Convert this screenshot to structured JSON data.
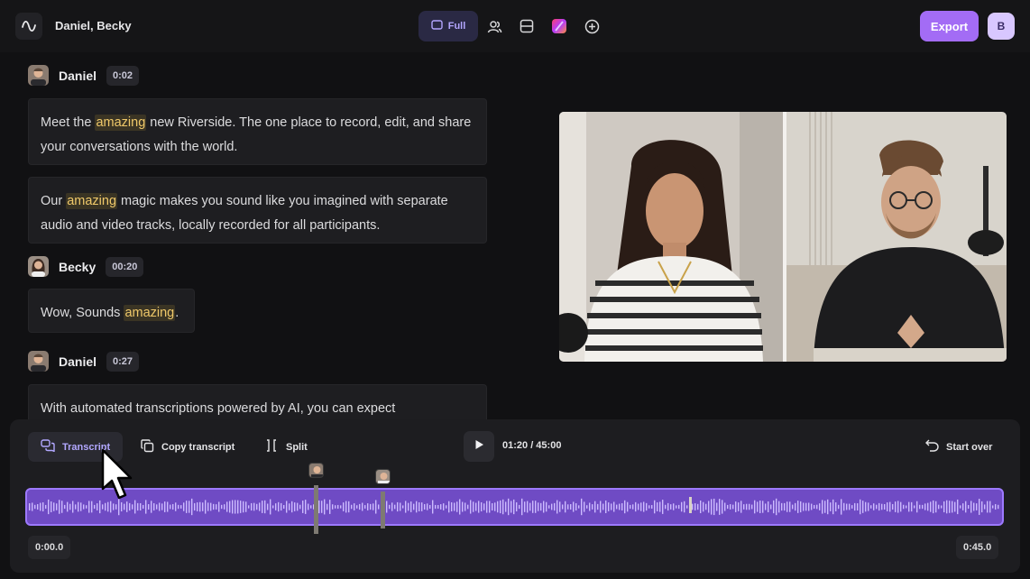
{
  "header": {
    "project_name": "Daniel, Becky",
    "view_full_label": "Full",
    "export_label": "Export",
    "user_initial": "B",
    "icons": [
      "waveform-logo-icon",
      "layout-full-icon",
      "people-icon",
      "split-layout-icon",
      "brand-gradient-icon",
      "add-circle-icon"
    ]
  },
  "transcript": {
    "segments": [
      {
        "speaker": "Daniel",
        "time": "0:02",
        "paragraphs": [
          {
            "before": "Meet the ",
            "highlight": "amazing",
            "after": " new Riverside. The one place to record, edit, and share your conversations with the world."
          },
          {
            "before": "Our ",
            "highlight": "amazing",
            "after": " magic makes you sound like you imagined with separate audio and video tracks, locally recorded for all participants."
          }
        ]
      },
      {
        "speaker": "Becky",
        "time": "00:20",
        "paragraphs": [
          {
            "before": "Wow, Sounds ",
            "highlight": "amazing",
            "after": "."
          }
        ]
      },
      {
        "speaker": "Daniel",
        "time": "0:27",
        "paragraphs": [
          {
            "before": "With automated transcriptions powered by AI, you can expect",
            "highlight": "",
            "after": ""
          }
        ]
      }
    ]
  },
  "toolbar": {
    "transcript_label": "Transcript",
    "copy_transcript_label": "Copy transcript",
    "split_label": "Split",
    "time_display": "01:20 / 45:00",
    "start_over_label": "Start over"
  },
  "timeline": {
    "start_time": "0:00.0",
    "end_time": "0:45.0"
  },
  "colors": {
    "accent": "#a36cf5",
    "highlight_text": "#f0c96a",
    "waveform_bg": "#6f4bc4"
  }
}
